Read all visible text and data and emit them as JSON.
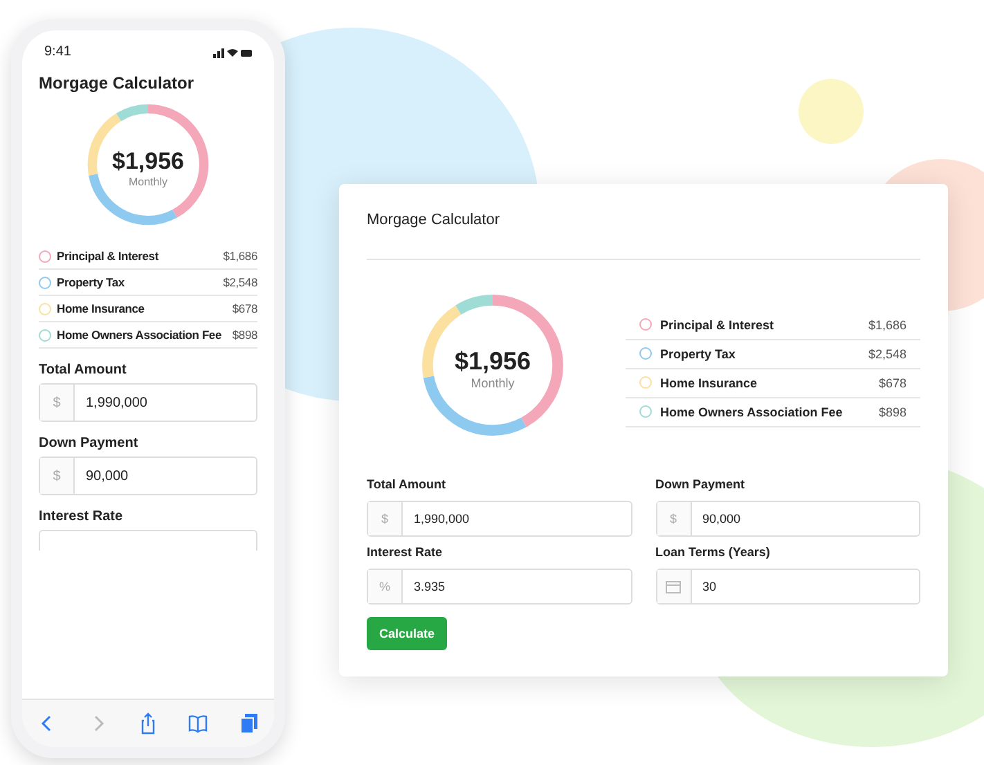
{
  "phone": {
    "time": "9:41",
    "title": "Morgage Calculator",
    "total": "$1,956",
    "period": "Monthly",
    "breakdown": [
      {
        "label": "Principal & Interest",
        "amount": "$1,686",
        "color": "#f4a7b9"
      },
      {
        "label": "Property Tax",
        "amount": "$2,548",
        "color": "#8ec9f0"
      },
      {
        "label": "Home Insurance",
        "amount": "$678",
        "color": "#fbe0a0"
      },
      {
        "label": "Home Owners Association Fee",
        "amount": "$898",
        "color": "#9fdcd6"
      }
    ],
    "fields": [
      {
        "label": "Total Amount",
        "kind": "text",
        "prefix": "$",
        "value": "1,990,000"
      },
      {
        "label": "Down Payment",
        "kind": "text",
        "prefix": "$",
        "value": "90,000"
      },
      {
        "label": "Interest Rate",
        "kind": "cut"
      }
    ]
  },
  "card": {
    "title": "Morgage Calculator",
    "total": "$1,956",
    "period": "Monthly",
    "breakdown": [
      {
        "label": "Principal & Interest",
        "amount": "$1,686",
        "color": "#f4a7b9"
      },
      {
        "label": "Property Tax",
        "amount": "$2,548",
        "color": "#8ec9f0"
      },
      {
        "label": "Home Insurance",
        "amount": "$678",
        "color": "#fbe0a0"
      },
      {
        "label": "Home Owners Association Fee",
        "amount": "$898",
        "color": "#9fdcd6"
      }
    ],
    "fields": [
      {
        "label": "Total Amount",
        "kind": "text",
        "prefix": "$",
        "value": "1,990,000"
      },
      {
        "label": "Down Payment",
        "kind": "text",
        "prefix": "$",
        "value": "90,000"
      },
      {
        "label": "Interest Rate",
        "kind": "text",
        "prefix": "%",
        "value": "3.935"
      },
      {
        "label": "Loan Terms (Years)",
        "kind": "calendar",
        "value": "30"
      }
    ],
    "button": "Calculate"
  }
}
